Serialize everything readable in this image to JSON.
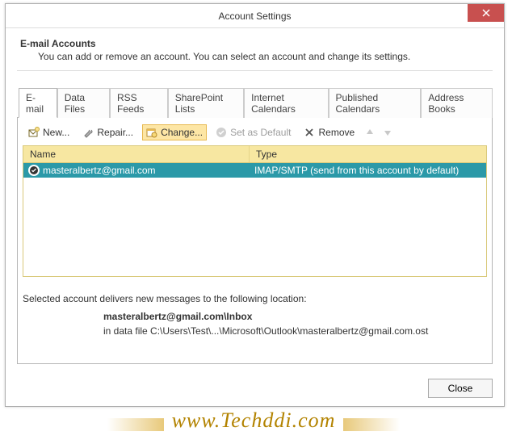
{
  "window": {
    "title": "Account Settings"
  },
  "header": {
    "title": "E-mail Accounts",
    "description": "You can add or remove an account. You can select an account and change its settings."
  },
  "tabs": [
    {
      "id": "email",
      "label": "E-mail",
      "active": true
    },
    {
      "id": "datafiles",
      "label": "Data Files",
      "active": false
    },
    {
      "id": "rss",
      "label": "RSS Feeds",
      "active": false
    },
    {
      "id": "sharepoint",
      "label": "SharePoint Lists",
      "active": false
    },
    {
      "id": "internet-cal",
      "label": "Internet Calendars",
      "active": false
    },
    {
      "id": "pub-cal",
      "label": "Published Calendars",
      "active": false
    },
    {
      "id": "address",
      "label": "Address Books",
      "active": false
    }
  ],
  "toolbar": {
    "new_label": "New...",
    "repair_label": "Repair...",
    "change_label": "Change...",
    "default_label": "Set as Default",
    "remove_label": "Remove"
  },
  "table": {
    "headers": {
      "name": "Name",
      "type": "Type"
    },
    "rows": [
      {
        "name": "masteralbertz@gmail.com",
        "type": "IMAP/SMTP (send from this account by default)",
        "selected": true,
        "default": true
      }
    ]
  },
  "delivery": {
    "intro": "Selected account delivers new messages to the following location:",
    "location_bold": "masteralbertz@gmail.com\\Inbox",
    "file_line": "in data file C:\\Users\\Test\\...\\Microsoft\\Outlook\\masteralbertz@gmail.com.ost"
  },
  "footer": {
    "close_label": "Close"
  },
  "watermark": {
    "text": "www.Techddi.com"
  }
}
